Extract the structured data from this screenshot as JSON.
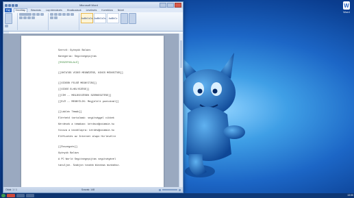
{
  "window": {
    "title": "Microsoft Word",
    "tabs": [
      "Fájl",
      "Kezdőlap",
      "Beszúrás",
      "Lap elrendezés",
      "Hivatkozások",
      "Levelezés",
      "Korrektúra",
      "Nézet"
    ],
    "active_tab": "Kezdőlap",
    "styles": [
      "AaBbCcDc",
      "AaBbCcDc",
      "AaBbCc"
    ]
  },
  "document": {
    "lines": [
      "Szerző: Gyönyük Balázs",
      "Kategória: Segítségnyújtás",
      "[ÖSSZEFOGLALÓ]",
      "",
      "[[OKTATÁS VIDEÓ MEGNÉZÉSE, NINCS MÓDOSÍTÁS]]",
      "",
      "[[VIDEÓK FELSŐ MEGNYITÁS]]",
      "[[VIDEÓ ELHELYEZÉSE]]",
      "[[CÍM -- MEGJEGYZÉSEK SZERKESZTÉSE]]",
      "[[ELŐ -- MEGNYÍLIK: Megjelölt pontoknál]]",
      "",
      "[[Lábléc Témák]]",
      "Elérhető tartalmak: segítséggel cikkek",
      "Kérdések a témában: kérdezz@poimmie.hu",
      "Vissza a kezdőlapra: kérdés@poimmie.hu",
      "Előfizetés az Internet alapú Hírlevélre",
      "",
      "[[Összegzés]]",
      "Gyönyük Balázs",
      "A PC World Segítségnyújtás segítségével",
      "tanuljon. Szabjon tovább Windows munkához."
    ],
    "green_line_index": 2
  },
  "statusbar": {
    "page": "Oldal: 1 / 1",
    "words": "Szavak: 148"
  },
  "desktop": {
    "icon_label": "Word"
  },
  "taskbar": {
    "time": "13:00"
  }
}
